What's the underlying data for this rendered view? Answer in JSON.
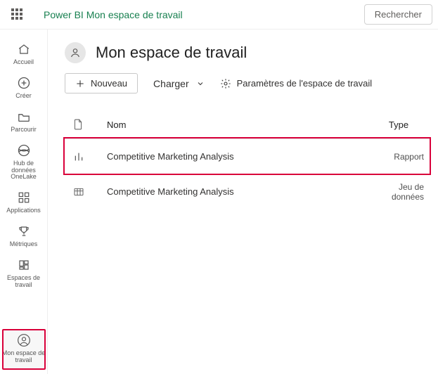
{
  "topbar": {
    "brand": "Power BI Mon espace de travail",
    "search_label": "Rechercher"
  },
  "sidebar": {
    "items": [
      {
        "label": "Accueil"
      },
      {
        "label": "Créer"
      },
      {
        "label": "Parcourir"
      },
      {
        "label": "Hub de données OneLake"
      },
      {
        "label": "Applications"
      },
      {
        "label": "Métriques"
      },
      {
        "label": "Espaces de travail"
      },
      {
        "label": "Mon espace de travail"
      }
    ]
  },
  "header": {
    "title": "Mon espace de travail"
  },
  "toolbar": {
    "new_label": "Nouveau",
    "upload_label": "Charger",
    "settings_label": "Paramètres de l'espace de travail"
  },
  "table": {
    "headers": {
      "name": "Nom",
      "type": "Type"
    },
    "rows": [
      {
        "name": "Competitive Marketing Analysis",
        "type": "Rapport"
      },
      {
        "name": "Competitive Marketing Analysis",
        "type": "Jeu de données"
      }
    ]
  }
}
